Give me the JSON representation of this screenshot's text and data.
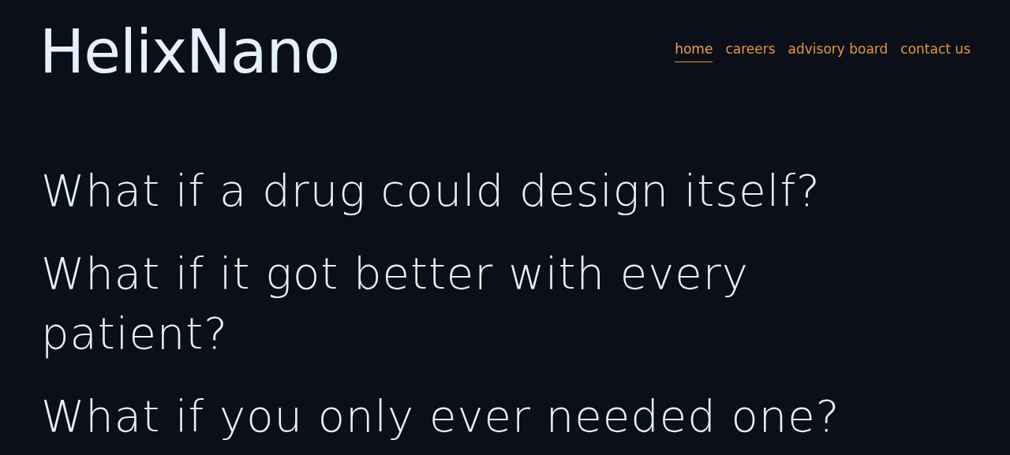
{
  "logo": "HelixNano",
  "nav": [
    {
      "label": "home",
      "selected": true
    },
    {
      "label": "careers",
      "selected": false
    },
    {
      "label": "advisory board",
      "selected": false
    },
    {
      "label": "contact us",
      "selected": false
    }
  ],
  "headlines": [
    "What if a drug could design itself?",
    "What if it got better with every patient?",
    "What if you only ever needed one?"
  ]
}
